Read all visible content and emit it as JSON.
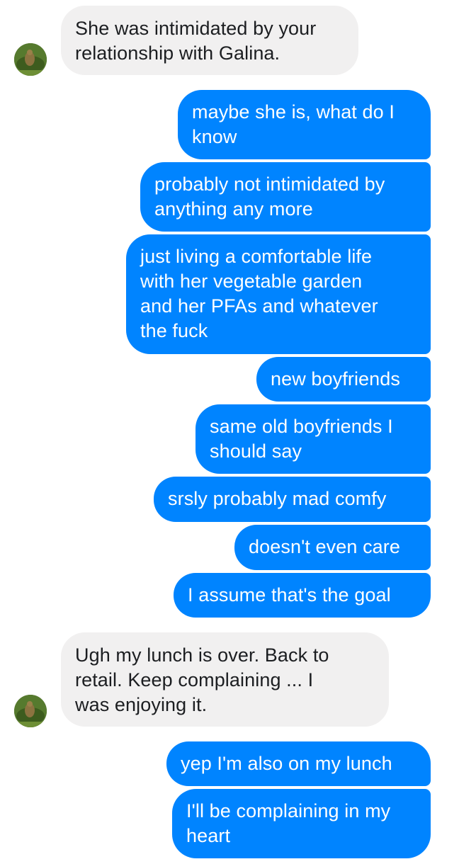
{
  "conversation": {
    "messages": [
      {
        "sender": "them",
        "text": "She was intimidated by your\nrelationship with Galina."
      },
      {
        "sender": "me",
        "text": "maybe she is, what do I\nknow"
      },
      {
        "sender": "me",
        "text": "probably not intimidated by\nanything any more"
      },
      {
        "sender": "me",
        "text": "just living a comfortable life\nwith her vegetable garden\nand her PFAs and whatever\nthe fuck"
      },
      {
        "sender": "me",
        "text": "new boyfriends"
      },
      {
        "sender": "me",
        "text": "same old boyfriends I\nshould say"
      },
      {
        "sender": "me",
        "text": "srsly probably mad comfy"
      },
      {
        "sender": "me",
        "text": "doesn't even care"
      },
      {
        "sender": "me",
        "text": "I assume that's the goal"
      },
      {
        "sender": "them",
        "text": "Ugh my lunch is over. Back to\nretail. Keep complaining ... I\nwas enjoying it."
      },
      {
        "sender": "me",
        "text": "yep I'm also on my lunch"
      },
      {
        "sender": "me",
        "text": "I'll be complaining in my\nheart"
      }
    ]
  },
  "colors": {
    "outgoing_bubble": "#0084ff",
    "incoming_bubble": "#f1f0f0",
    "outgoing_text": "#ffffff",
    "incoming_text": "#1c1e21"
  },
  "icons": {
    "contact_avatar": "avatar-photo-icon"
  }
}
